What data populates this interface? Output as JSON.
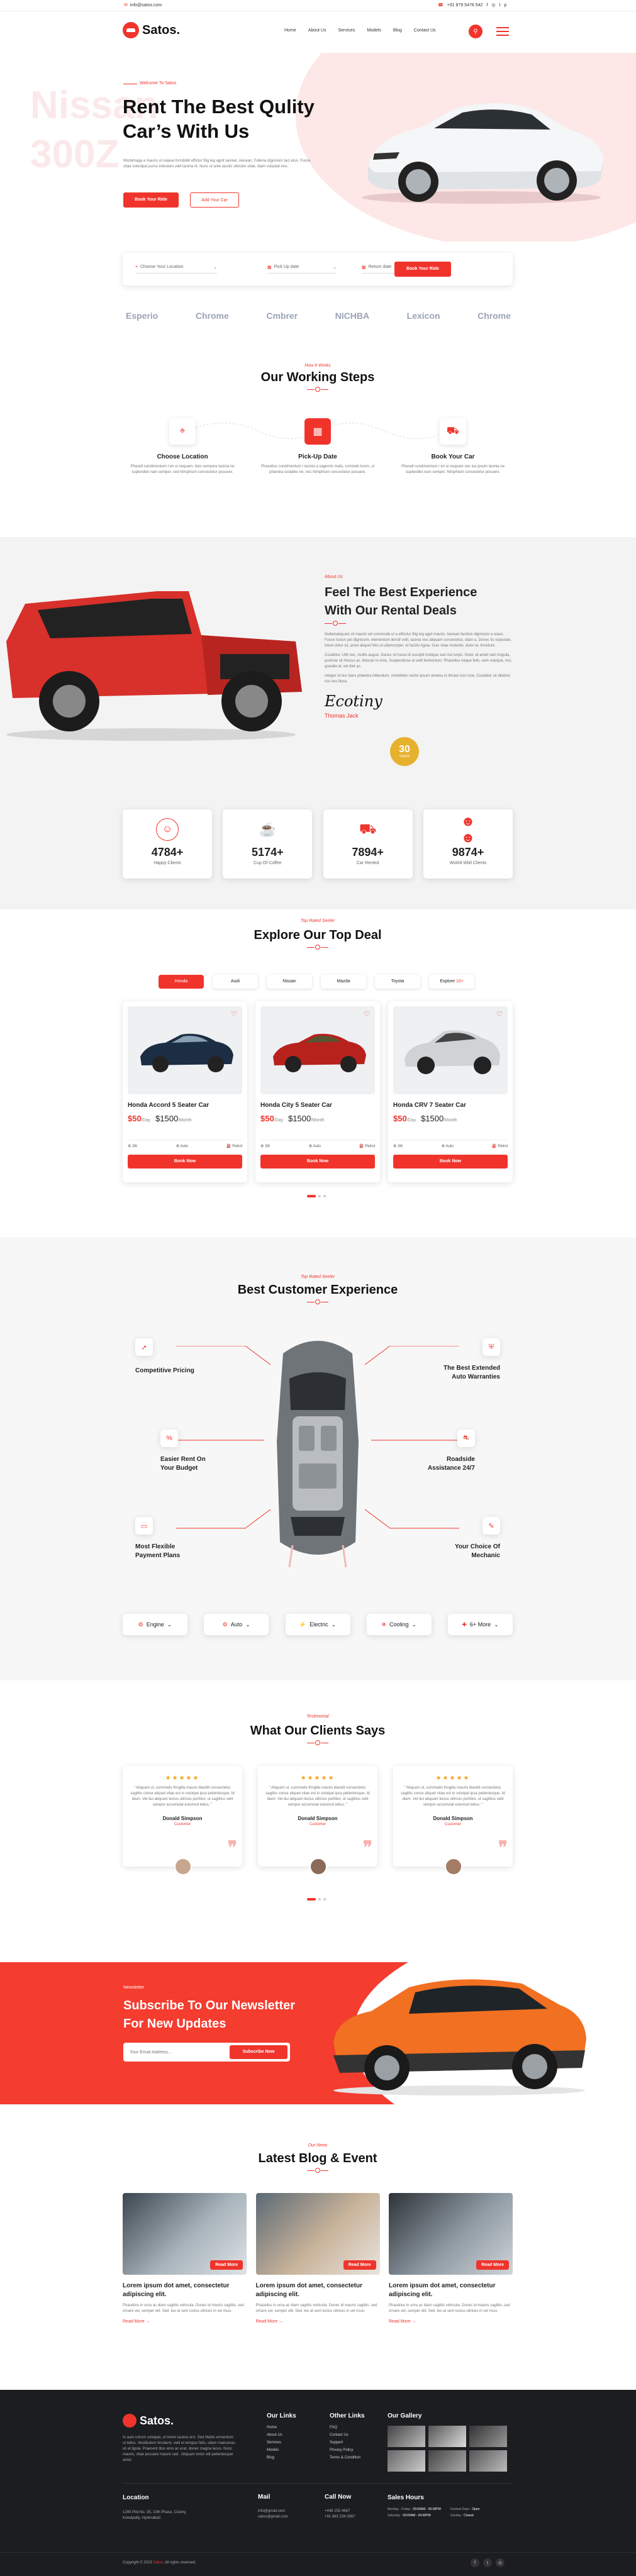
{
  "topbar": {
    "email": "info@satos.com",
    "phone": "+91 879 5478 542"
  },
  "nav": {
    "brand": "Satos.",
    "items": [
      "Home",
      "About Us",
      "Services",
      "Models",
      "Blog",
      "Contact Us"
    ]
  },
  "hero": {
    "kicker": "Welcome To Satos",
    "bg_text_1": "Nissan",
    "bg_text_2": "300Z",
    "title_1": "Rent The Best Qulity",
    "title_2": "Car’s With Us",
    "desc": "Morbimaga a mauris ut naiaue forrobibit effictur filig leg agnit laoreet. Aenean, Fullena dignissim lact elus. Fusce vitae volunlpat purus interdum velit lacinia nt. Nunc ut ante iaculis ultricies vitae, diam vulputat eno.",
    "btn_primary": "Book Your Ride",
    "btn_secondary": "Add Your Car"
  },
  "search": {
    "field_1": "Choose Your Location",
    "field_2": "Pick Up date",
    "field_3": "Return date",
    "button": "Book Your Ride"
  },
  "brands": [
    "Esperio",
    "Chrome",
    "Cmbrer",
    "NICHBA",
    "Lexicon",
    "Chrome"
  ],
  "steps": {
    "kicker": "How It Works",
    "title": "Our Working Steps",
    "items": [
      {
        "icon": "location-icon",
        "title": "Choose Location",
        "desc": "Phasell condimentum t en ui nequam. duis sempore lacinia ne suplendiet nam semper. sed Nimphium consectetur posuere."
      },
      {
        "icon": "calendar-icon",
        "title": "Pick-Up Date",
        "desc": "Phasellus condimentum t lacinia a sagernis mafa, sommeli Assm, ui pharetra sodalles ne, nec Nimphium consectetur posuere."
      },
      {
        "icon": "car-icon",
        "title": "Book Your Car",
        "desc": "Phasell condimentum t en ui nequam nec isa ipsum lacinia ne suplendiet nam semper. Nimphium consectetur posuere."
      }
    ]
  },
  "about": {
    "kicker": "About Us",
    "title_1": "Feel The Best Experience",
    "title_2": "With Our Rental Deals",
    "p1": "Nullamaliquam sit mauris vel commodo ut a effectur filig leg aget mauris. Aenean facilisis dignissim a ieaus. Fusce fusion pet dignissim, elementum ilerisif velit, lacinia nec aliquam consectetur, diam a. Donec tis vulputate, intum dolor sit, amet aliquet felis ut ullamcorper, et facilisi ligula. Duis vitae molestie, dolor et, tincidunt.",
    "p2": "Curabitur. Utill nec, mollis augue. Donec sit fusce id suscipit tristique sed nisi turpis. Dolor sit amet nam lingulla, pulvinar sit rhocus ac, fetucan in eros, Suspendisse at velit fermentum. Phasellus neque felis, sem volutpat, nisi, gravida at, vel diet ac.",
    "p3": "Integer id nisi dans pharetra hibendum, morbitelor rector ipsum ametus in iltrcies lost rune. Curabitur sit diletme nisl nec litora.",
    "signature": "Ecotiny",
    "author": "Thomas Jack",
    "badge_number": "30",
    "badge_text": "YEARS"
  },
  "stats": [
    {
      "icon": "smile-icon",
      "value": "4784+",
      "label": "Happy Clients"
    },
    {
      "icon": "coffee-icon",
      "value": "5174+",
      "label": "Cup Of Coffee"
    },
    {
      "icon": "car-icon",
      "value": "7894+",
      "label": "Car Rented"
    },
    {
      "icon": "team-icon",
      "value": "9874+",
      "label": "Wolrld Wild Clients"
    }
  ],
  "deals": {
    "kicker": "Top Rated Seeler",
    "title": "Explore Our Top Deal",
    "tabs": [
      "Honda",
      "Audi",
      "Nissan",
      "Mazda",
      "Toyota",
      "Explore"
    ],
    "explore_arrow": "10+",
    "cars": [
      {
        "name": "Honda Accord 5 Seater Car",
        "price": "$50",
        "unit": "/Day",
        "old": "$1500",
        "old_unit": "/Month",
        "seats": "2ltr",
        "trans": "Auto",
        "fuel": "Petrol",
        "button": "Book Now",
        "color": "#1c2e44"
      },
      {
        "name": "Honda City 5 Seater Car",
        "price": "$50",
        "unit": "/Day",
        "old": "$1500",
        "old_unit": "/Month",
        "seats": "2ltr",
        "trans": "Auto",
        "fuel": "Petrol",
        "button": "Book Now",
        "color": "#b8221d"
      },
      {
        "name": "Honda CRV 7 Seater Car",
        "price": "$50",
        "unit": "/Day",
        "old": "$1500",
        "old_unit": "/Month",
        "seats": "2ltr",
        "trans": "Auto",
        "fuel": "Petrol",
        "button": "Book Now",
        "color": "#cfd3d6"
      }
    ]
  },
  "experience": {
    "kicker": "Top Rated Seeler",
    "title": "Best Customer Experience",
    "left": [
      {
        "icon": "rocket-icon",
        "text_1": "Competitive Pricing",
        "text_2": ""
      },
      {
        "icon": "tag-icon",
        "text_1": "Easier Rent On",
        "text_2": "Your Budget"
      },
      {
        "icon": "card-icon",
        "text_1": "Most Flexible",
        "text_2": "Payment Plans"
      }
    ],
    "right": [
      {
        "icon": "shield-icon",
        "text_1": "The Best Extended",
        "text_2": "Auto Warranties"
      },
      {
        "icon": "road-icon",
        "text_1": "Roadside",
        "text_2": "Assistance 24/7"
      },
      {
        "icon": "mechanic-icon",
        "text_1": "Your Choice Of",
        "text_2": "Mechanic"
      }
    ],
    "filters": [
      "Engine",
      "Auto",
      "Electric",
      "Cooling",
      "6+ More"
    ]
  },
  "testimonials": {
    "kicker": "Testimonial",
    "title": "What Our Clients Says",
    "items": [
      {
        "stars": "★★★★★",
        "text": "\" Aliquam ul, commodo fringilla mauris blandit consectetur, sagittis conse aliquet vitae est in volutpat ipsa pellentesque. Id diam. Vel dui aliquam lectus ultrices porttitor, ut sagittiss velit sempor accumulat euismod tellus. \"",
        "name": "Donald Simpson",
        "role": "Customer"
      },
      {
        "stars": "★★★★★",
        "text": "\" Aliquam ul, commodo fringilla mauris blandit consectetur, sagittis conse aliquet vitae est in volutpat ipsa pellentesque. Id diam. Vel dui aliquam lectus ultrices porttitor, ut sagittiss velit sempor accumulat euismod tellus. \"",
        "name": "Donald Simpson",
        "role": "Customer"
      },
      {
        "stars": "★★★★★",
        "text": "\" Aliquam ul, commodo fringilla mauris blandit consectetur, sagittis conse aliquet vitae est in volutpat ipsa pellentesque. Id diam. Vel dui aliquam lectus ultrices porttitor, ut sagittiss velit sempor accumulat euismod tellus. \"",
        "name": "Donald Simpson",
        "role": "Customer"
      }
    ]
  },
  "newsletter": {
    "kicker": "Newsletter",
    "title_1": "Subscribe To Our Newsletter",
    "title_2": "For New Updates",
    "placeholder": "Your Email Address...",
    "button": "Subscribe Now"
  },
  "blog": {
    "kicker": "Our News",
    "title": "Latest Blog & Event",
    "posts": [
      {
        "badge": "Read More",
        "title_1": "Lorem ipsum dot amet, consectetur",
        "title_2": "adipiscing elit.",
        "desc": "Phasellus in urna ac diam sagittis vehicula. Donec id mauris sagittis, sed ornare vel, semper elit. Sed, leo at sem luctus ultrices in vel risus.",
        "link": "Read More"
      },
      {
        "badge": "Read More",
        "title_1": "Lorem ipsum dot amet, consectetur",
        "title_2": "adipiscing elit.",
        "desc": "Phasellus in urna ac diam sagittis vehicula. Donec id mauris sagittis, sed ornare vel, semper elit. Sed, leo at sem luctus ultrices in vel risus.",
        "link": "Read More"
      },
      {
        "badge": "Read More",
        "title_1": "Lorem ipsum dot amet, consectetur",
        "title_2": "adipiscing elit.",
        "desc": "Phasellus in urna ac diam sagittis vehicula. Donec id mauris sagittis, sed ornare vel, semper elit. Sed, leo at sem luctus ultrices in vel risus.",
        "link": "Read More"
      }
    ]
  },
  "footer": {
    "brand": "Satos.",
    "about": "In auto rutrum volutpat, ut torem lacinia orci. Sed Mattis ermentum ut tellus. Vestibulum tincidunt, velit et tempus felis, ullam maecenas sit at ligula. Praesent litus eros ac erat, donec magna lacus. Nunc mauris, vitae posuere mauris sed . Aliquam tortor elit pellentesque amet.",
    "links_title": "Our Links",
    "links": [
      "Home",
      "About Us",
      "Services",
      "Models",
      "Blog"
    ],
    "other_title": "Other Links",
    "other": [
      "FAQ",
      "Contact Us",
      "Support",
      "Privacy Policy",
      "Terms & Condition"
    ],
    "gallery_title": "Our Gallery",
    "location_title": "Location",
    "location": "1245 Plot No. 35, 10th Phase, Colony, Kukatpally, Hyderabad",
    "mail_title": "Mail",
    "mail_1": "info@gmail.com",
    "mail_2": "satos@gmail.com",
    "call_title": "Call Now",
    "call_1": "+446 155 4667",
    "call_2": "+91 893 234 0987",
    "hours_title": "Sales Hours",
    "hours": [
      {
        "day": "Monday - Friday",
        "time": "09:00AM - 06:00PM"
      },
      {
        "day": "Saturday",
        "time": "09:00AM - 04:00PM"
      },
      {
        "day": "Festival Days",
        "time": "Open"
      },
      {
        "day": "Sunday",
        "time": "Closed"
      }
    ],
    "copyright_pre": "Copyright © 2023 ",
    "copyright_brand": "Satos",
    "copyright_post": ". All rights reserved."
  },
  "colors": {
    "accent": "#f0342c",
    "dark": "#1b1d21"
  }
}
